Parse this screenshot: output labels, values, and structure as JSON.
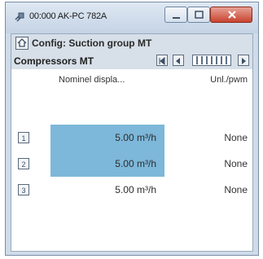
{
  "window": {
    "title": "00:000 AK-PC 782A",
    "icon": "plug-icon"
  },
  "caption_buttons": {
    "minimize": "minimize-icon",
    "maximize": "maximize-icon",
    "close": "close-icon"
  },
  "config": {
    "label": "Config: Suction group MT",
    "icon": "home-icon"
  },
  "compressors": {
    "label": "Compressors MT"
  },
  "table": {
    "headers": [
      "Nominel displa...",
      "Unl./pwm"
    ],
    "rows": [
      {
        "index": "1",
        "value": "5.00 m³/h",
        "unit": "None",
        "highlighted": true
      },
      {
        "index": "2",
        "value": "5.00 m³/h",
        "unit": "None",
        "highlighted": true
      },
      {
        "index": "3",
        "value": "5.00 m³/h",
        "unit": "None",
        "highlighted": false
      }
    ]
  },
  "colors": {
    "highlight": "#7db7d9",
    "bar": "#d7dfe8",
    "close_button": "#c8432f"
  }
}
